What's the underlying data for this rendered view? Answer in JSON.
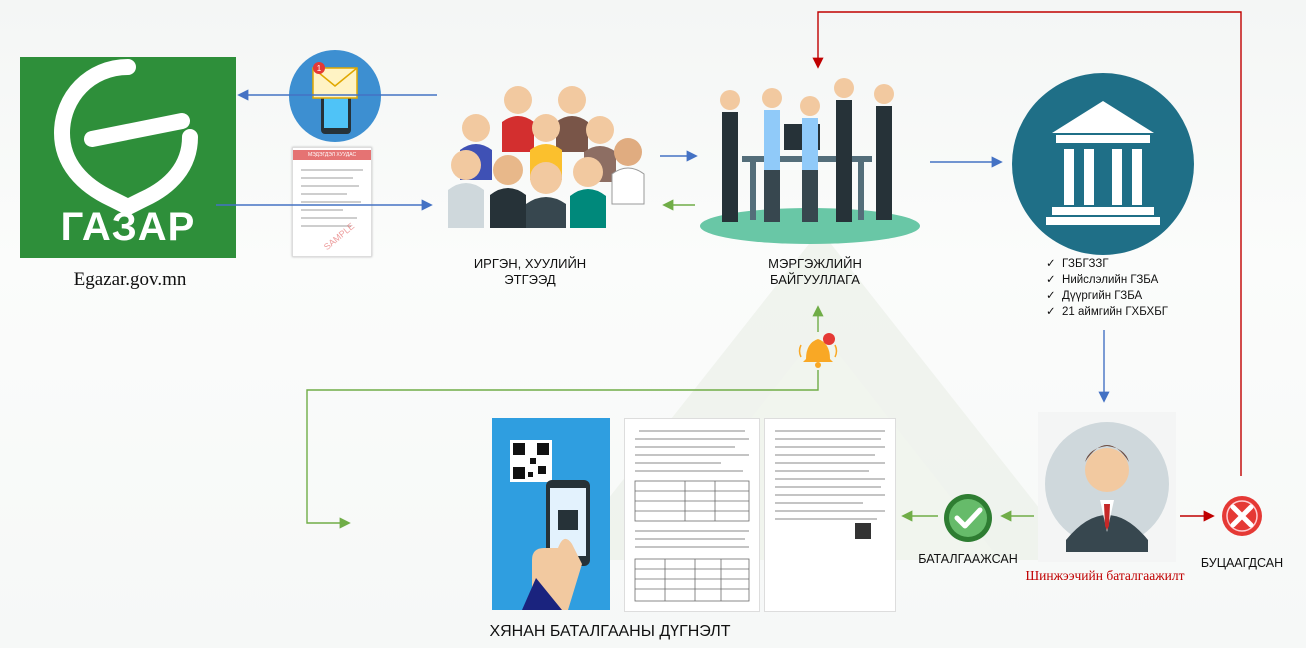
{
  "logo": {
    "text": "ГАЗАР",
    "site": "Egazar.gov.mn"
  },
  "nodes": {
    "citizens": "ИРГЭН, ХУУЛИЙН ЭТГЭЭД",
    "professional": "МЭРГЭЖЛИЙН БАЙГУУЛЛАГА",
    "verified": "БАТАЛГААЖСАН",
    "rejected": "БУЦААГДСАН",
    "expert": "Шинжээчийн баталгаажилт",
    "bottom_title": "ХЯНАН БАТАЛГААНЫ ДҮГНЭЛТ"
  },
  "agencies": [
    "ГЗБГЗЗГ",
    "Нийслэлийн ГЗБА",
    "Дүүргийн ГЗБА",
    "21 аймгийн ГХБХБГ"
  ],
  "document": {
    "stamp_title": "МЭДЭГДЭЛ ХУУДАС"
  },
  "notification_badge": "1",
  "colors": {
    "logo_green": "#2e8f3a",
    "blue_arrow": "#4472c4",
    "green_arrow": "#70ad47",
    "red_arrow": "#c00000",
    "bank_circle": "#1f6f87"
  }
}
